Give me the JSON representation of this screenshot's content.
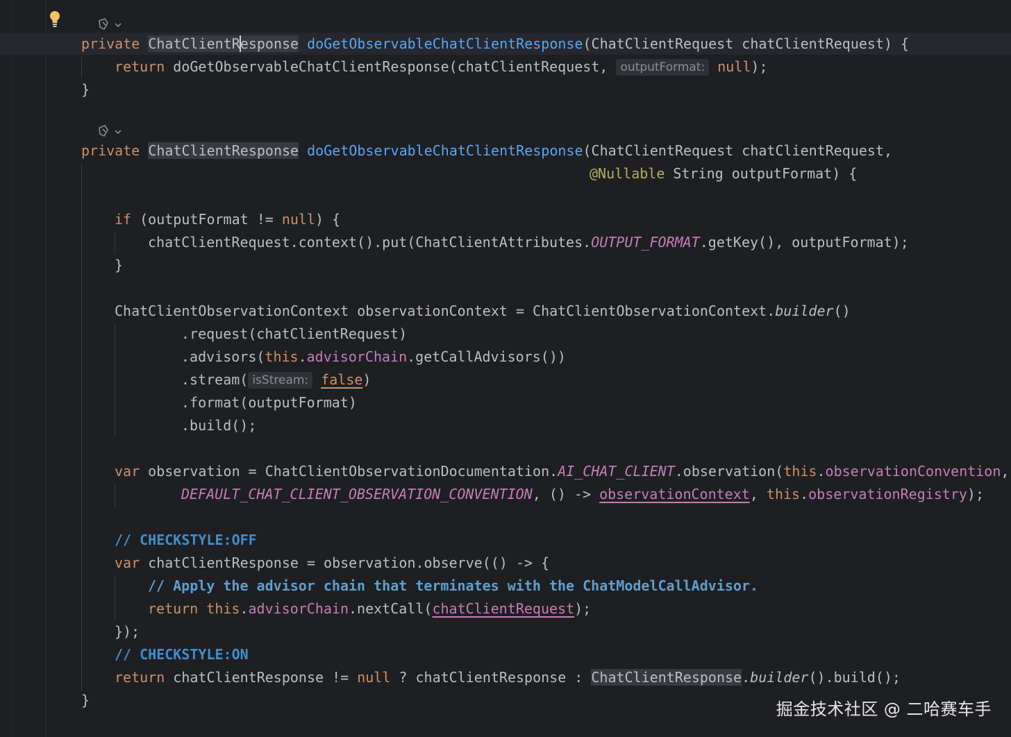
{
  "hints": {
    "output_format_label": "outputFormat:",
    "is_stream_label": "isStream:"
  },
  "lines": {
    "l1": {
      "kw1": "private",
      "type": "ChatClientResponse",
      "name": "doGetObservableChatClientResponse",
      "rest": "(ChatClientRequest chatClientRequest) {"
    },
    "l2": {
      "kw": "return",
      "call": "doGetObservableChatClientResponse(chatClientRequest, ",
      "null_kw": "null",
      "tail": ");"
    },
    "l3": {
      "text": "}"
    },
    "l4": {
      "kw1": "private",
      "type": "ChatClientResponse",
      "name": "doGetObservableChatClientResponse",
      "rest": "(ChatClientRequest chatClientRequest,"
    },
    "l5": {
      "anno": "@Nullable",
      "rest": " String outputFormat) {"
    },
    "l6": {
      "kw": "if",
      "mid": " (outputFormat != ",
      "null_kw": "null",
      "tail": ") {"
    },
    "l7": {
      "pre": "chatClientRequest.context().put(ChatClientAttributes.",
      "const": "OUTPUT_FORMAT",
      "post": ".getKey(), outputFormat);"
    },
    "l8": {
      "text": "}"
    },
    "l9": {
      "pre": "ChatClientObservationContext observationContext = ChatClientObservationContext.",
      "italic": "builder",
      "post": "()"
    },
    "l10": {
      "text": ".request(chatClientRequest)"
    },
    "l11": {
      "pre": ".advisors(",
      "this": "this",
      "dot": ".",
      "field": "advisorChain",
      "post": ".getCallAdvisors())"
    },
    "l12": {
      "pre": ".stream(",
      "false_kw": "false",
      "post": ")"
    },
    "l13": {
      "text": ".format(outputFormat)"
    },
    "l14": {
      "text": ".build();"
    },
    "l15": {
      "kw": "var",
      "pre": " observation = ChatClientObservationDocumentation.",
      "const": "AI_CHAT_CLIENT",
      "mid": ".observation(",
      "this": "this",
      "dot": ".",
      "field": "observationConvention",
      "post": ","
    },
    "l16": {
      "const": "DEFAULT_CHAT_CLIENT_OBSERVATION_CONVENTION",
      "mid": ", () -> ",
      "field_ul": "observationContext",
      "sep": ", ",
      "this": "this",
      "dot": ".",
      "field": "observationRegistry",
      "post": ");"
    },
    "l17": {
      "text": "// CHECKSTYLE:OFF"
    },
    "l18": {
      "kw": "var",
      "rest": " chatClientResponse = observation.observe(() -> {"
    },
    "l19": {
      "text": "// Apply the advisor chain that terminates with the ChatModelCallAdvisor."
    },
    "l20": {
      "kw": "return",
      "sp": " ",
      "this": "this",
      "dot": ".",
      "field": "advisorChain",
      "mid": ".nextCall(",
      "ul": "chatClientRequest",
      "post": ");"
    },
    "l21": {
      "text": "});"
    },
    "l22": {
      "text": "// CHECKSTYLE:ON"
    },
    "l23": {
      "kw": "return",
      "pre": " chatClientResponse != ",
      "null_kw": "null",
      "mid": " ? chatClientResponse : ",
      "type": "ChatClientResponse",
      "dot": ".",
      "italic": "builder",
      "post": "().build();"
    },
    "l24": {
      "text": "}"
    }
  },
  "watermark": "掘金技术社区 @ 二哈赛车手",
  "colors": {
    "background": "#1e1f22",
    "keyword": "#cf8e6d",
    "method_decl": "#56a8f5",
    "field": "#c77dbb",
    "annotation": "#b3ae60",
    "comment": "#5f9fcf"
  }
}
